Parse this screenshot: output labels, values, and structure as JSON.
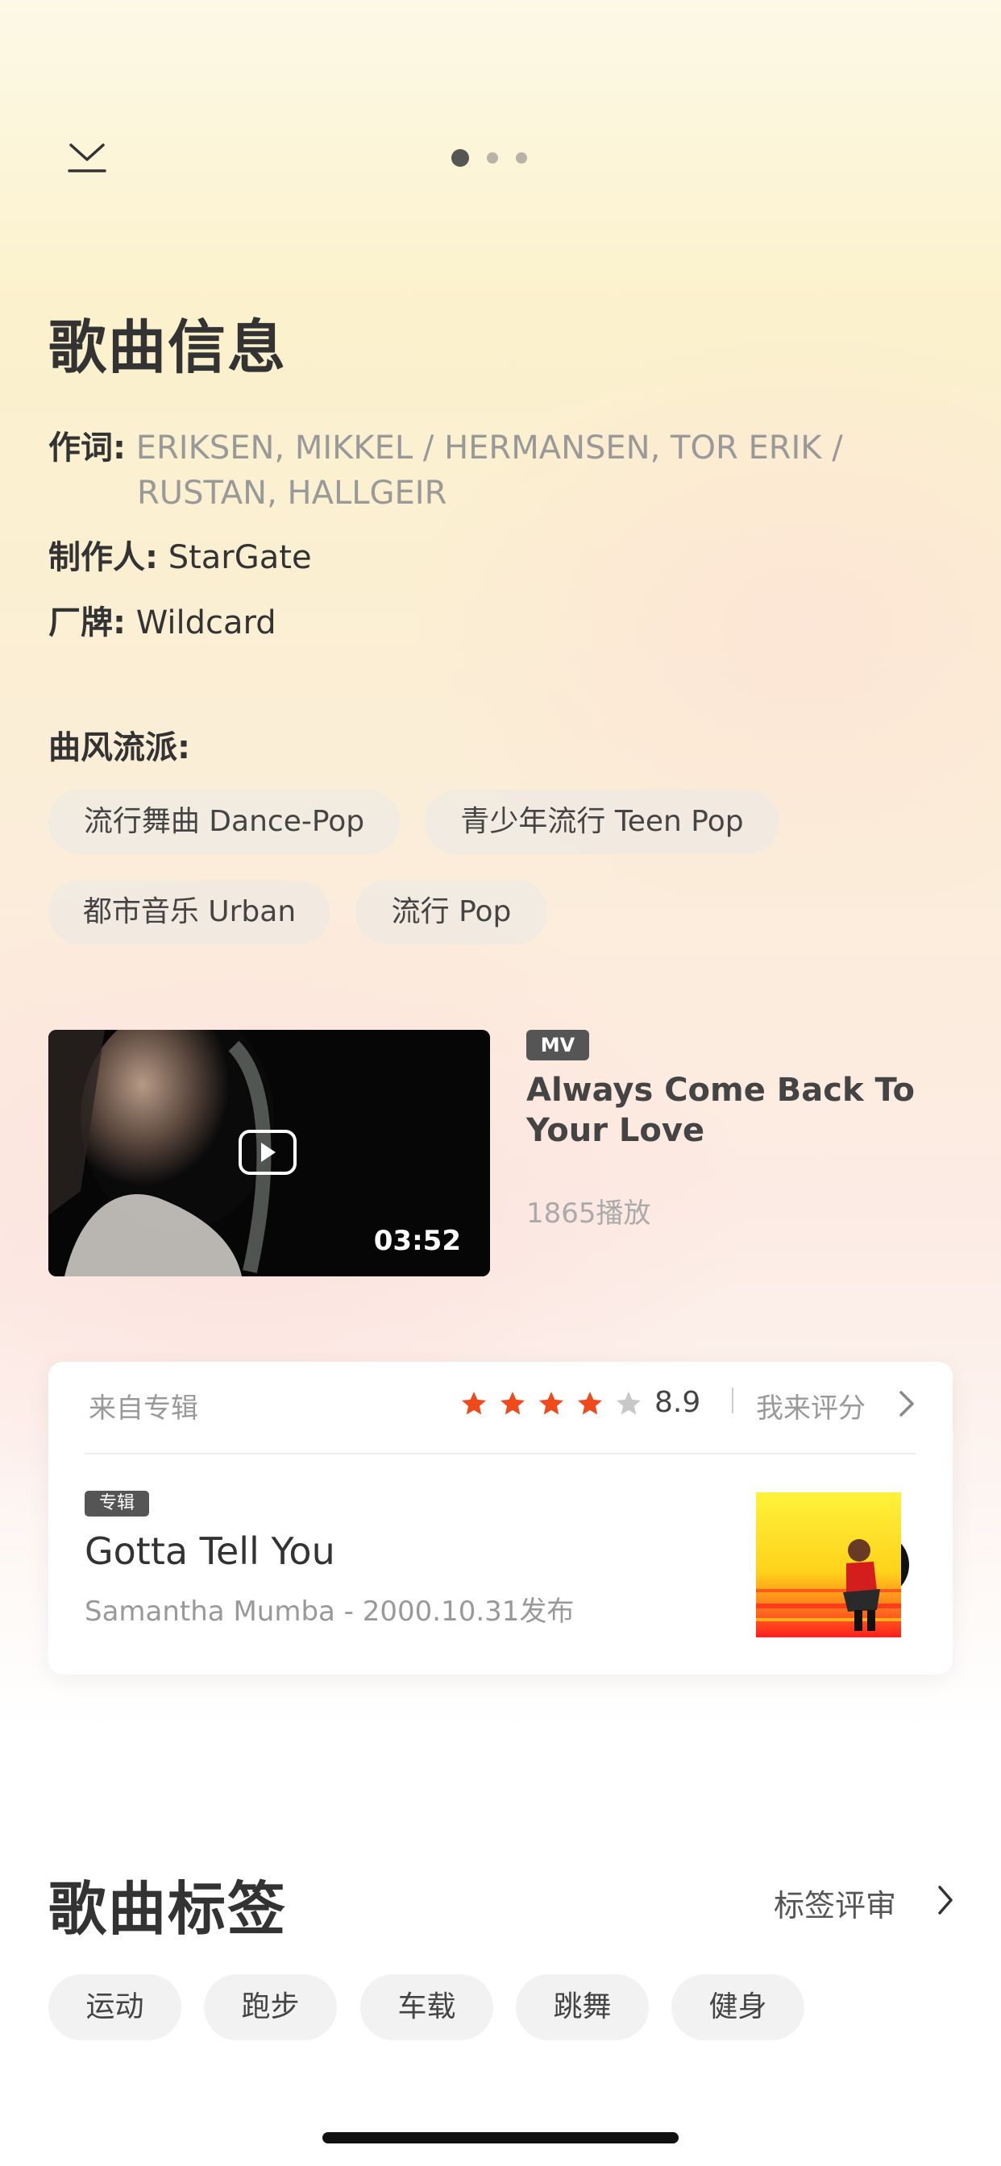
{
  "header": {
    "page_dots_count": 3,
    "active_page": 1
  },
  "song_info": {
    "title": "歌曲信息",
    "lyricist_label": "作词:",
    "lyricist_line1": "ERIKSEN, MIKKEL / HERMANSEN, TOR ERIK /",
    "lyricist_line2": "RUSTAN, HALLGEIR",
    "producer_label": "制作人:",
    "producer_value": "StarGate",
    "label_label": "厂牌:",
    "label_value": "Wildcard",
    "genre_label": "曲风流派:",
    "genres": [
      "流行舞曲 Dance-Pop",
      "青少年流行 Teen Pop",
      "都市音乐 Urban",
      "流行 Pop"
    ]
  },
  "mv": {
    "badge": "MV",
    "title_line1": "Always Come Back To",
    "title_line2": "Your Love",
    "duration": "03:52",
    "plays": "1865播放"
  },
  "album": {
    "from_label": "来自专辑",
    "rating": "8.9",
    "stars_filled": 4,
    "stars_total": 5,
    "rate_label": "我来评分",
    "badge": "专辑",
    "name": "Gotta Tell You",
    "artist_date": "Samantha Mumba - 2000.10.31发布",
    "accent_star_color": "#f04a1c"
  },
  "tags": {
    "title": "歌曲标签",
    "review_label": "标签评审",
    "items": [
      "运动",
      "跑步",
      "车载",
      "跳舞",
      "健身"
    ]
  }
}
